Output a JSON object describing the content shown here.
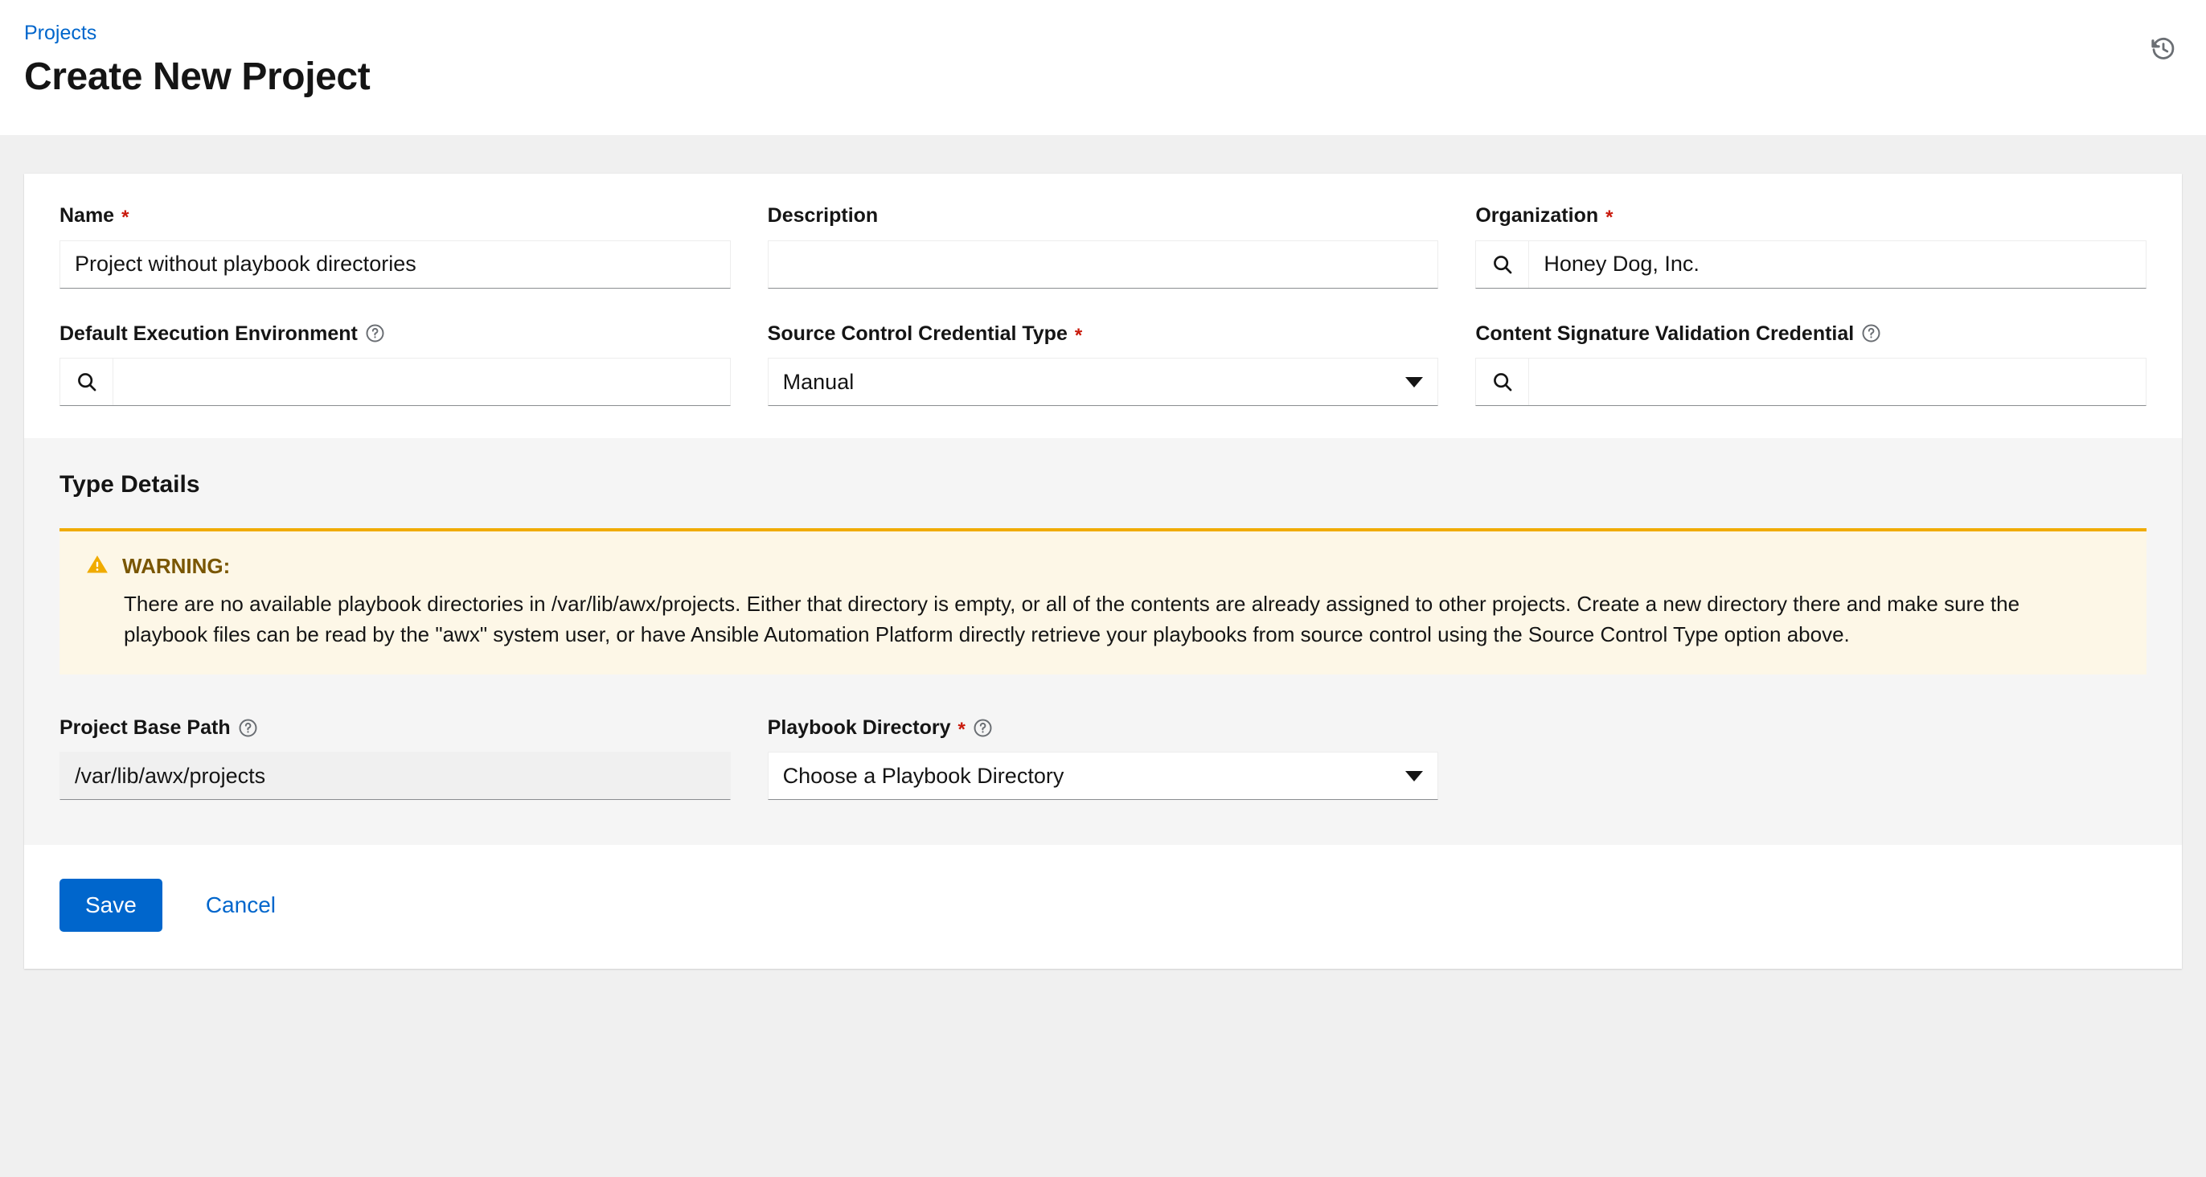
{
  "header": {
    "breadcrumb": "Projects",
    "title": "Create New Project",
    "history_icon": "history-icon"
  },
  "form": {
    "fields": {
      "name": {
        "label": "Name",
        "required": true,
        "value": "Project without playbook directories"
      },
      "description": {
        "label": "Description",
        "required": false,
        "value": "",
        "placeholder": ""
      },
      "organization": {
        "label": "Organization",
        "required": true,
        "value": "Honey Dog, Inc.",
        "search_icon": "search-icon"
      },
      "default_execution_environment": {
        "label": "Default Execution Environment",
        "required": false,
        "value": "",
        "help_icon": "question-circle-icon",
        "search_icon": "search-icon"
      },
      "source_control_credential_type": {
        "label": "Source Control Credential Type",
        "required": true,
        "value": "Manual",
        "caret_icon": "caret-down-icon"
      },
      "content_signature_validation_credential": {
        "label": "Content Signature Validation Credential",
        "required": false,
        "value": "",
        "help_icon": "question-circle-icon",
        "search_icon": "search-icon"
      }
    }
  },
  "type_details": {
    "title": "Type Details",
    "alert": {
      "icon": "warning-triangle-icon",
      "title": "WARNING:",
      "text": "There are no available playbook directories in /var/lib/awx/projects. Either that directory is empty, or all of the contents are already assigned to other projects. Create a new directory there and make sure the playbook files can be read by the \"awx\" system user, or have Ansible Automation Platform directly retrieve your playbooks from source control using the Source Control Type option above.",
      "border_color": "#f0ab00",
      "background_color": "#fdf7e7"
    },
    "fields": {
      "project_base_path": {
        "label": "Project Base Path",
        "required": false,
        "value": "/var/lib/awx/projects",
        "disabled": true,
        "help_icon": "question-circle-icon"
      },
      "playbook_directory": {
        "label": "Playbook Directory",
        "required": true,
        "value": "Choose a Playbook Directory",
        "help_icon": "question-circle-icon",
        "caret_icon": "caret-down-icon"
      }
    }
  },
  "footer": {
    "save_label": "Save",
    "cancel_label": "Cancel"
  },
  "colors": {
    "accent": "#0066cc",
    "required": "#c9190b",
    "warning": "#f0ab00",
    "warning_text": "#795600",
    "page_background": "#f0f0f0",
    "section_background": "#f5f5f5"
  }
}
